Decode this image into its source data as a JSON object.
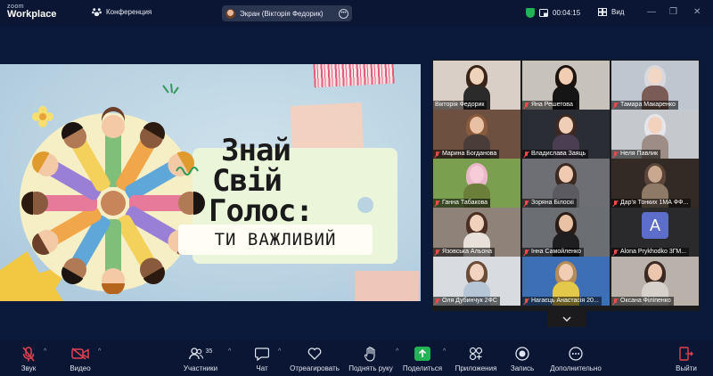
{
  "topbar": {
    "logo_line1": "zoom",
    "logo_line2": "Workplace",
    "meeting_label": "Конференция",
    "share_pill_label": "Экран (Вікторія Федорик)",
    "timer": "00:04:15",
    "view_label": "Вид"
  },
  "slide": {
    "title_line1": "Знай",
    "title_line2": "Свій",
    "title_line3": "Голос:",
    "subtitle": "ТИ ВАЖЛИВИЙ"
  },
  "participants": [
    {
      "name": "Вікторія Федорик",
      "muted": false
    },
    {
      "name": "Яна Решетова",
      "muted": true
    },
    {
      "name": "Тамара Макаренко",
      "muted": true
    },
    {
      "name": "Марина Богданова",
      "muted": true
    },
    {
      "name": "Владислава Заяць",
      "muted": true
    },
    {
      "name": "Неля Павлик",
      "muted": true
    },
    {
      "name": "Ганна Табакова",
      "muted": true
    },
    {
      "name": "Зоряна Білоскі",
      "muted": true
    },
    {
      "name": "Дар'я Тонких 1МА ФФ...",
      "muted": true
    },
    {
      "name": "Язовська Альона",
      "muted": true
    },
    {
      "name": "Інна Самойленко",
      "muted": true
    },
    {
      "name": "Alona Prykhodko 3ГМ...",
      "muted": true,
      "initial": "A"
    },
    {
      "name": "Оля Дубинчук 2ФС",
      "muted": true
    },
    {
      "name": "Нагаєць Анастасія 20...",
      "muted": true
    },
    {
      "name": "Оксана Філіпенко",
      "muted": true
    }
  ],
  "toolbar": {
    "audio": "Звук",
    "video": "Видео",
    "participants": "Участники",
    "participants_count": "35",
    "chat": "Чат",
    "react": "Отреагировать",
    "raise_hand": "Поднять руку",
    "share": "Поделиться",
    "apps": "Приложения",
    "record": "Запись",
    "more": "Дополнительно",
    "leave": "Выйти"
  },
  "colors": {
    "bg": "#0b1a3a",
    "share_green": "#21b356",
    "active_speaker": "#25c46a",
    "muted_red": "#ff4a4a",
    "leave_red": "#e0434f"
  }
}
